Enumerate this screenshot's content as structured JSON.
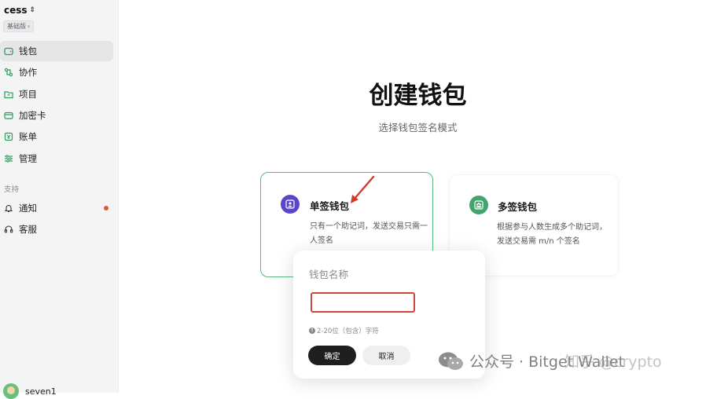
{
  "sidebar": {
    "workspace": "cess",
    "plan": "基础版",
    "nav": [
      {
        "label": "钱包",
        "icon": "wallet-icon"
      },
      {
        "label": "协作",
        "icon": "collaborate-icon"
      },
      {
        "label": "项目",
        "icon": "project-icon"
      },
      {
        "label": "加密卡",
        "icon": "card-icon"
      },
      {
        "label": "账单",
        "icon": "bill-icon"
      },
      {
        "label": "管理",
        "icon": "settings-sliders-icon"
      }
    ],
    "support_label": "支持",
    "support": [
      {
        "label": "通知",
        "icon": "bell-icon"
      },
      {
        "label": "客服",
        "icon": "headset-icon"
      }
    ],
    "user": "seven1"
  },
  "main": {
    "title": "创建钱包",
    "subtitle": "选择钱包签名模式",
    "cards": [
      {
        "title": "单签钱包",
        "desc": "只有一个助记词，发送交易只需一人签名",
        "icon": "single-user-icon"
      },
      {
        "title": "多签钱包",
        "desc": "根据参与人数生成多个助记词，发送交易需 m/n 个签名",
        "icon": "multi-user-icon"
      }
    ]
  },
  "dialog": {
    "label": "钱包名称",
    "input_value": "",
    "hint": "2-20位（包含）字符",
    "ok": "确定",
    "cancel": "取消"
  },
  "watermarks": {
    "wechat": "公众号 · Bitget Wallet",
    "zhihu": "知乎 @crypto"
  },
  "colors": {
    "accent_green": "#58b97a",
    "single_icon_bg": "#5b46c8",
    "multi_icon_bg": "#43a56d",
    "input_border_red": "#d2453a",
    "notification_dot": "#e0563b"
  }
}
